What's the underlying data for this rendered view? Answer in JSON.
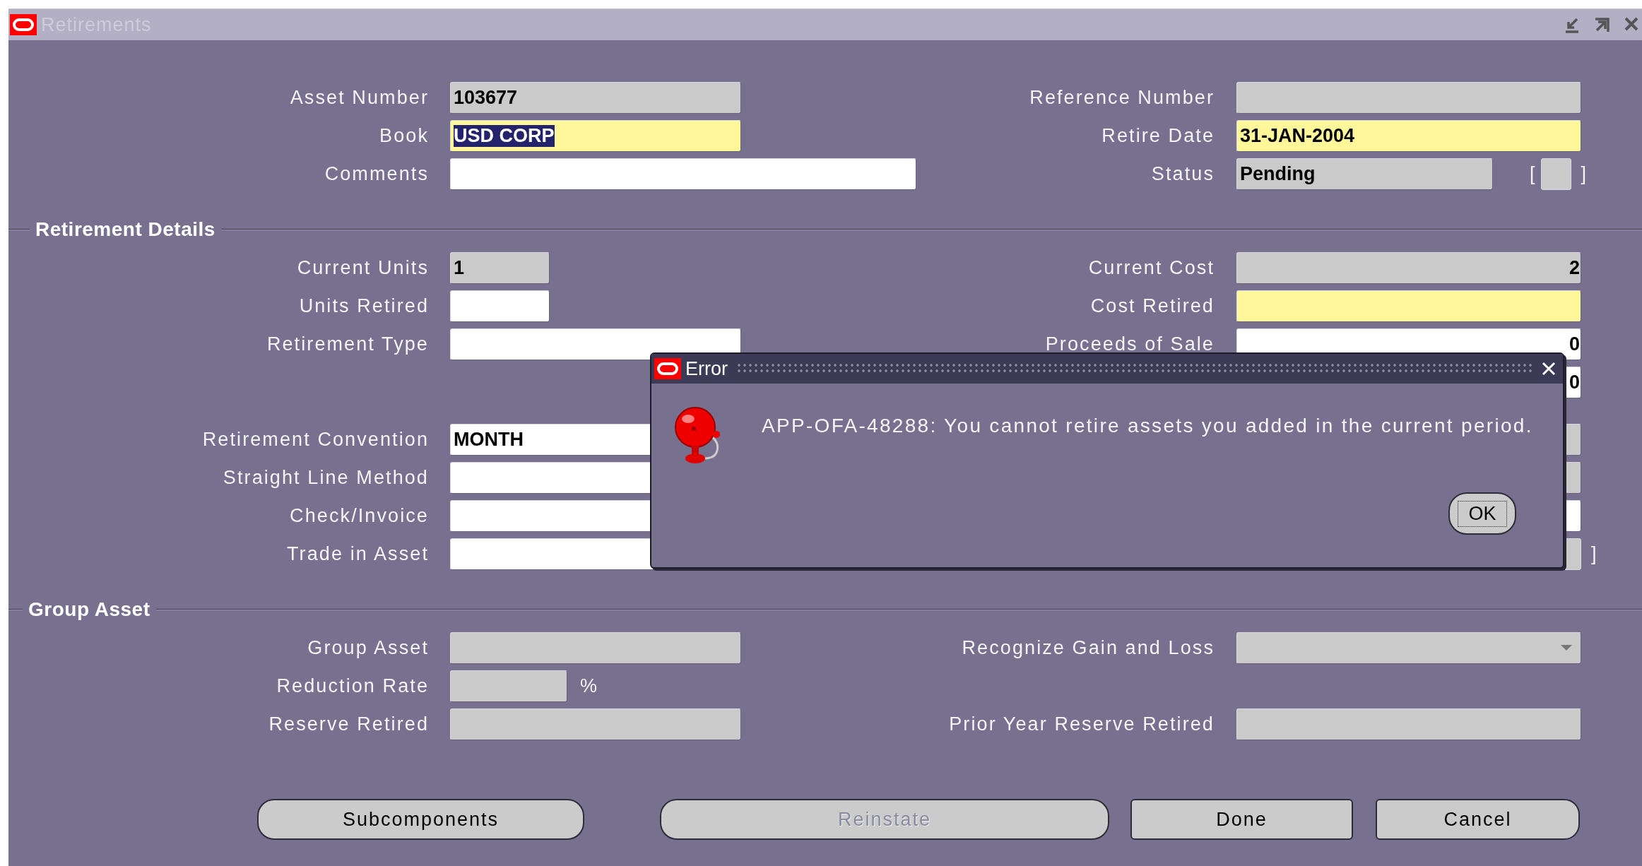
{
  "window": {
    "title": "Retirements"
  },
  "top_rows": [
    {
      "left": {
        "label": "Asset Number",
        "value": "103677",
        "readonly": true,
        "kind": "text"
      },
      "right": {
        "label": "Reference Number",
        "readonly": true,
        "kind": "text"
      }
    },
    {
      "left": {
        "label": "Book",
        "value": "USD CORP",
        "readonly": false,
        "required": true,
        "kind": "text",
        "text_selected": true
      },
      "right": {
        "label": "Retire Date",
        "value": "31-JAN-2004",
        "readonly": false,
        "required": true,
        "kind": "text"
      }
    },
    {
      "left": {
        "label": "Comments",
        "readonly": false,
        "required": false,
        "kind": "text"
      },
      "right": {
        "label": "Status",
        "value": "Pending",
        "readonly": true,
        "kind": "text",
        "flexfield": {
          "open": "[",
          "close": "]"
        }
      }
    }
  ],
  "sections": [
    {
      "title": "Retirement Details",
      "rows": [
        {
          "left": {
            "label": "Current Units",
            "value": "1",
            "readonly": true,
            "kind": "text"
          },
          "right": {
            "label": "Current Cost",
            "value": "2",
            "readonly": true,
            "kind": "number"
          }
        },
        {
          "left": {
            "label": "Units Retired",
            "readonly": false,
            "required": false,
            "kind": "text"
          },
          "right": {
            "label": "Cost Retired",
            "readonly": false,
            "required": true,
            "kind": "number"
          }
        },
        {
          "left": {
            "label": "Retirement Type",
            "readonly": false,
            "required": false,
            "kind": "text"
          },
          "right": {
            "label": "Proceeds of Sale",
            "value": "0",
            "readonly": false,
            "required": false,
            "kind": "number"
          }
        },
        {
          "right": {
            "value": "0",
            "readonly": false,
            "required": false,
            "kind": "number"
          }
        },
        {
          "left": {
            "label": "Retirement Convention",
            "value": "MONTH",
            "readonly": false,
            "required": false,
            "kind": "text"
          },
          "right": {
            "readonly": true,
            "kind": "text"
          }
        },
        {
          "left": {
            "label": "Straight Line Method",
            "readonly": false,
            "required": false,
            "kind": "text"
          },
          "right": {
            "readonly": true,
            "kind": "text"
          }
        },
        {
          "left": {
            "label": "Check/Invoice",
            "readonly": false,
            "required": false,
            "kind": "text"
          },
          "right": {
            "readonly": false,
            "required": false,
            "kind": "text"
          }
        },
        {
          "left": {
            "label": "Trade in Asset",
            "readonly": false,
            "required": false,
            "kind": "text"
          },
          "right": {
            "kind": "flex",
            "flexfield": {
              "close": "]"
            }
          }
        }
      ]
    },
    {
      "title": "Group Asset",
      "rows": [
        {
          "left": {
            "label": "Group Asset",
            "readonly": true,
            "kind": "text"
          },
          "right": {
            "label": "Recognize Gain and Loss",
            "readonly": true,
            "kind": "select"
          }
        },
        {
          "left": {
            "label": "Reduction Rate",
            "readonly": true,
            "kind": "text",
            "suffix": "%"
          }
        },
        {
          "left": {
            "label": "Reserve Retired",
            "readonly": true,
            "kind": "text"
          },
          "right": {
            "label": "Prior Year Reserve Retired",
            "readonly": true,
            "kind": "text"
          }
        }
      ]
    }
  ],
  "buttons": [
    {
      "label": "Subcomponents",
      "disabled": false
    },
    {
      "label": "Reinstate",
      "disabled": true
    },
    {
      "label": "Done",
      "disabled": false
    },
    {
      "label": "Cancel",
      "disabled": false
    }
  ],
  "dialog": {
    "title": "Error",
    "message": "APP-OFA-48288: You cannot retire assets you added in the current period.",
    "button": {
      "label": "OK",
      "focused": true
    }
  }
}
